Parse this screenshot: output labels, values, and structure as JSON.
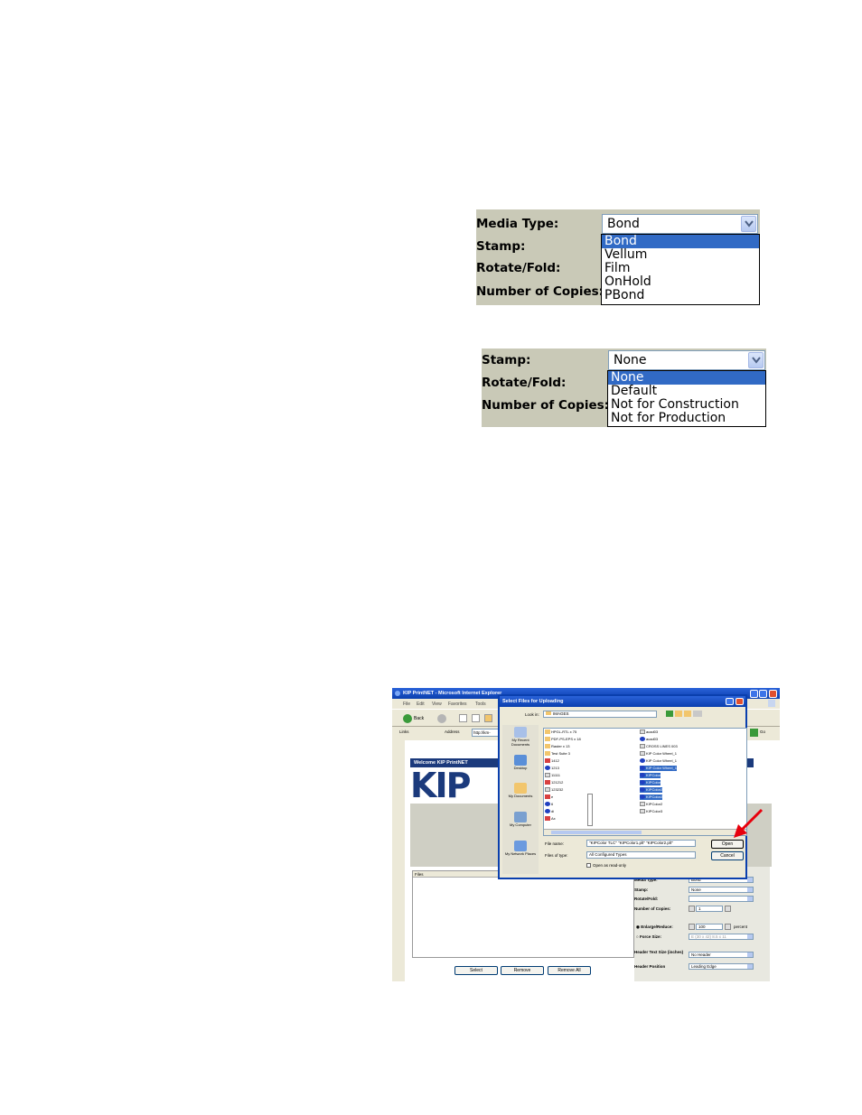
{
  "panel_media": {
    "labels": [
      "Media Type:",
      "Stamp:",
      "Rotate/Fold:",
      "Number of Copies:"
    ],
    "selected_value": "Bond",
    "options": [
      "Bond",
      "Vellum",
      "Film",
      "OnHold",
      "PBond"
    ],
    "highlighted_index": 0
  },
  "panel_stamp": {
    "labels": [
      "Stamp:",
      "Rotate/Fold:",
      "Number of Copies:"
    ],
    "selected_value": "None",
    "options": [
      "None",
      "Default",
      "Not for Construction",
      "Not for Production"
    ],
    "highlighted_index": 0
  },
  "browser": {
    "title": "KIP PrintNET - Microsoft Internet Explorer",
    "menu": [
      "File",
      "Edit",
      "View",
      "Favorites",
      "Tools"
    ],
    "back_label": "Back",
    "links_label": "Links",
    "address_label": "Address",
    "address_value": "http://km-",
    "go_label": "Go",
    "welcome": "Welcome KIP PrintNET",
    "logo": "KIP",
    "files_header": "Files",
    "buttons": {
      "select": "Select",
      "remove": "Remove",
      "remove_all": "Remove All"
    },
    "settings": {
      "media_type_label": "Media Type:",
      "media_type_value": "Bond",
      "stamp_label": "Stamp:",
      "stamp_value": "None",
      "rotate_label": "Rotate/Fold:",
      "rotate_value": "",
      "copies_label": "Number of Copies:",
      "copies_value": "1",
      "enlarge_label": "Enlarge/Reduce:",
      "enlarge_value": "100",
      "enlarge_unit": "percent",
      "force_label": "Force Size:",
      "force_value": "E (30 x 42) 8.5 x 11",
      "header_size_label": "Header Text Size (inches)",
      "header_size_value": "No Header",
      "header_pos_label": "Header Position",
      "header_pos_value": "Leading Edge"
    }
  },
  "dialog": {
    "title": "Select Files for Uploading",
    "look_in_label": "Look in:",
    "look_in_value": "IMAGES",
    "places": [
      "My Recent Documents",
      "Desktop",
      "My Documents",
      "My Computer",
      "My Network Places"
    ],
    "files_col1": [
      "HPGL-RTL x 75",
      "PDF-PS-EPS x 18",
      "Raster x 13",
      "Test Suite 3",
      "1412",
      "1213",
      "11111",
      "121212",
      "123232",
      "e",
      "6",
      "di",
      "Ax"
    ],
    "files_col2": [
      "acad03",
      "acad03",
      "CROSS LINES 003",
      "KIP Color Wheel_1",
      "KIP Color Wheel_1",
      "KIP Color Wheel_1",
      "KIPColor",
      "KIPColor",
      "KIPColor2",
      "KIPColor2",
      "KIPColor2",
      "KIPColor3"
    ],
    "file_name_label": "File name:",
    "file_name_value": "\"KIPColor TLC\" \"KIPColor1.plt\" \"KIPColor2.plt\"",
    "file_type_label": "Files of type:",
    "file_type_value": "All Configured Types",
    "readonly_label": "Open as read-only",
    "open_label": "Open",
    "cancel_label": "Cancel"
  },
  "colors": {
    "panel_bg": "#c9c9b7",
    "highlight": "#316ac5",
    "xp_blue": "#0a3fae",
    "kip_blue": "#1b3a7c",
    "arrow_red": "#e8000c"
  }
}
